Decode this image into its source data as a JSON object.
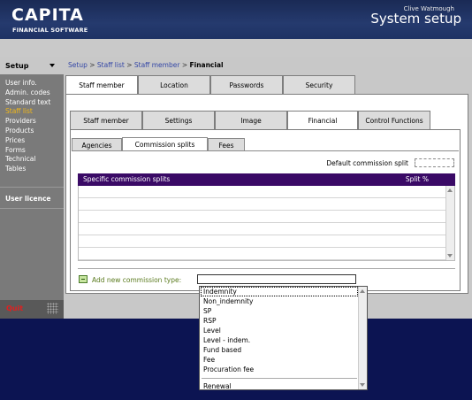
{
  "header": {
    "brand": "CAPITA",
    "brand_sub": "FINANCIAL SOFTWARE",
    "title": "System setup",
    "user": "Clive Watmough"
  },
  "sidebar": {
    "title": "Setup",
    "items": [
      {
        "label": "User info.",
        "active": false
      },
      {
        "label": "Admin. codes",
        "active": false
      },
      {
        "label": "Standard text",
        "active": false
      },
      {
        "label": "Staff list",
        "active": true
      },
      {
        "label": "Providers",
        "active": false
      },
      {
        "label": "Products",
        "active": false
      },
      {
        "label": "Prices",
        "active": false
      },
      {
        "label": "Forms",
        "active": false
      },
      {
        "label": "Technical",
        "active": false
      },
      {
        "label": "Tables",
        "active": false
      }
    ],
    "licence": "User licence",
    "quit": "Quit"
  },
  "breadcrumb": {
    "items": [
      "Setup",
      "Staff list",
      "Staff member"
    ],
    "separator": ">",
    "current": "Financial"
  },
  "tabs_top": [
    "Staff member",
    "Location",
    "Passwords",
    "Security"
  ],
  "tabs_second": [
    "Staff member",
    "Settings",
    "Image",
    "Financial",
    "Control Functions"
  ],
  "tabs_third": [
    "Agencies",
    "Commission splits",
    "Fees"
  ],
  "commission": {
    "default_label": "Default commission split",
    "default_value": "",
    "grid_headers": [
      "Specific commission splits",
      "Split %"
    ],
    "add_label": "Add new commission type:",
    "add_value": ""
  },
  "dropdown_options": [
    "Indemnity",
    "Non_indemnity",
    "SP",
    "RSP",
    "Level",
    "Level - indem.",
    "Fund based",
    "Fee",
    "Procuration fee",
    "",
    "Renewal"
  ],
  "colors": {
    "background": "#0c1452",
    "header": "#253a6e",
    "grid_header": "#3a0a66",
    "active_sidebar": "#f2b818",
    "quit": "#e02020"
  }
}
